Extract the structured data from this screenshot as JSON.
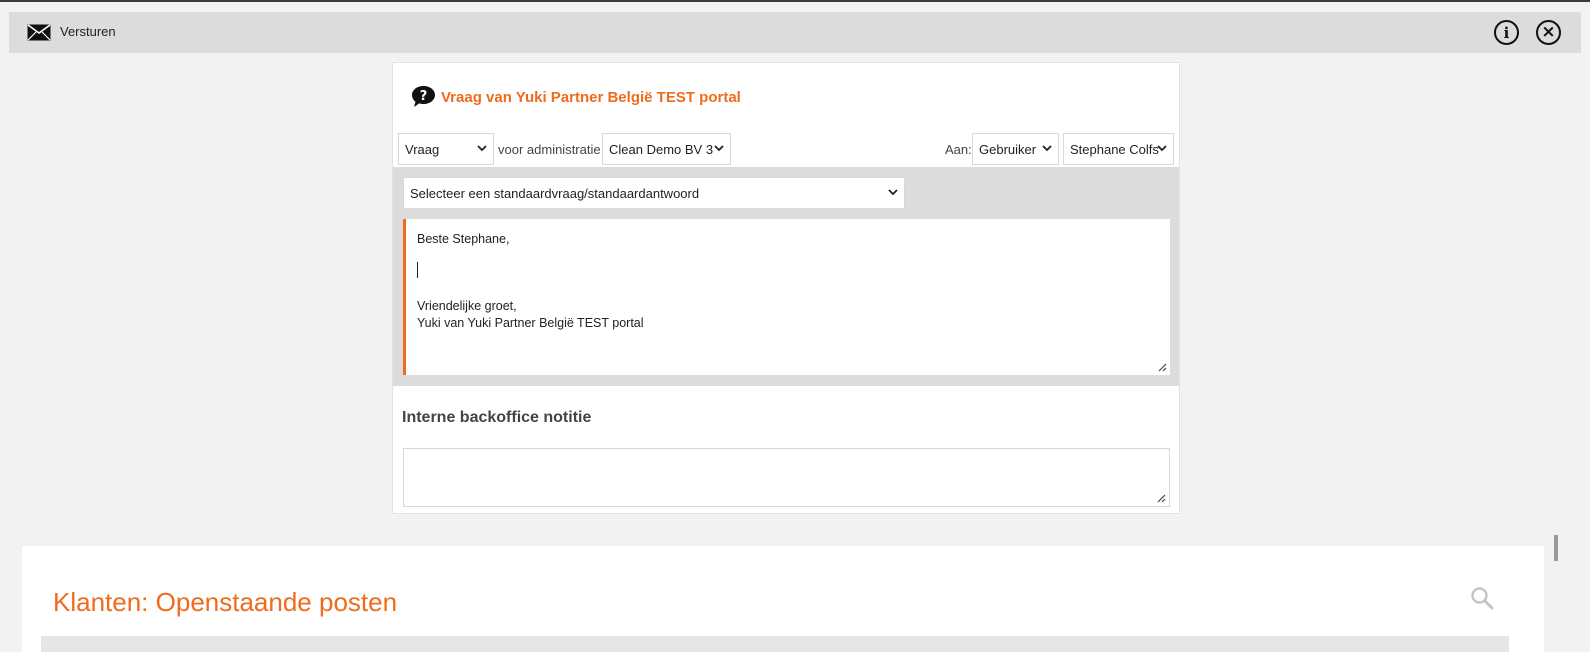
{
  "toolbar": {
    "send_label": "Versturen",
    "send_icon": "envelope-icon",
    "info_icon": "info-icon",
    "close_icon": "close-icon"
  },
  "question_panel": {
    "icon": "question-bubble-icon",
    "title": "Vraag van Yuki Partner België TEST portal",
    "type_select": "Vraag",
    "for_admin_label": "voor administratie",
    "admin_select": "Clean Demo BV 3",
    "to_label": "Aan:",
    "recipient_type_select": "Gebruiker",
    "recipient_select": "Stephane Colfs",
    "standard_select": "Selecteer een standaardvraag/standaardantwoord",
    "message": {
      "greeting": "Beste Stephane,",
      "closing": "Vriendelijke groet,",
      "signature": "Yuki van Yuki Partner België TEST portal"
    },
    "internal_note_title": "Interne backoffice notitie",
    "internal_note_value": ""
  },
  "customers_card": {
    "title": "Klanten: Openstaande posten",
    "search_icon": "search-icon"
  },
  "colors": {
    "accent": "#ef6c1c",
    "toolbar_bg": "#dcdcdc",
    "page_bg": "#f2f2f2"
  }
}
